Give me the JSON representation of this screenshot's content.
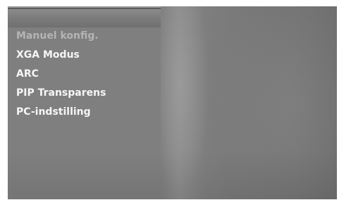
{
  "menu": {
    "items": [
      {
        "label": "Manuel konfig.",
        "state": "disabled"
      },
      {
        "label": "XGA Modus",
        "state": "enabled"
      },
      {
        "label": "ARC",
        "state": "enabled"
      },
      {
        "label": "PIP Transparens",
        "state": "enabled"
      },
      {
        "label": "PC-indstilling",
        "state": "enabled"
      }
    ]
  },
  "colors": {
    "panel": "#7f7f7f",
    "text": "#f6f6f6",
    "text_disabled": "#b4b4b4"
  }
}
